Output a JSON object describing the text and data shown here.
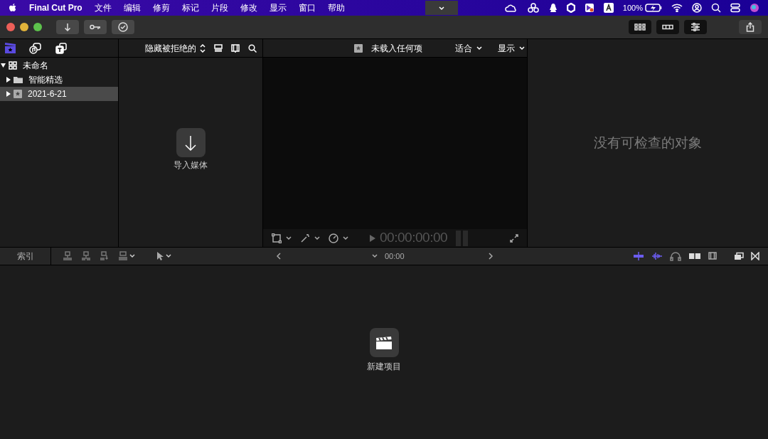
{
  "menu_bar": {
    "app_name": "Final Cut Pro",
    "items": [
      "文件",
      "编辑",
      "修剪",
      "标记",
      "片段",
      "修改",
      "显示",
      "窗口",
      "帮助"
    ],
    "battery": "100%"
  },
  "browser_toolbar": {
    "filter": "隐藏被拒绝的"
  },
  "libraries": [
    {
      "label": "未命名",
      "kind": "library",
      "expanded": true,
      "selected": false,
      "children": [
        {
          "label": "智能精选",
          "kind": "folder",
          "expanded": false,
          "selected": false
        },
        {
          "label": "2021-6-21",
          "kind": "event",
          "expanded": false,
          "selected": true
        }
      ]
    }
  ],
  "browser": {
    "import_label": "导入媒体"
  },
  "viewer": {
    "title": "未载入任何项",
    "zoom": "适合",
    "display": "显示",
    "timecode": "00:00:00:00"
  },
  "inspector": {
    "empty_message": "没有可检查的对象"
  },
  "timeline": {
    "index_button": "索引",
    "timecode": "00:00",
    "toggles": [
      {
        "kind": "snapping",
        "on": true
      },
      {
        "kind": "skimming",
        "on": true
      },
      {
        "kind": "audio",
        "on": false
      }
    ],
    "new_project_label": "新建项目"
  }
}
